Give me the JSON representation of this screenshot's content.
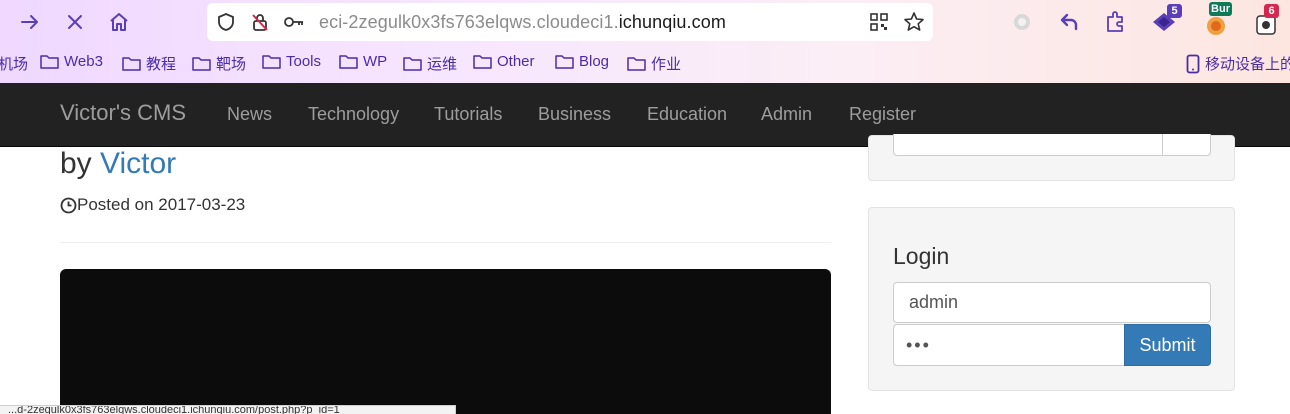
{
  "browser": {
    "url_prefix": "eci-2zegulk0x3fs763elqws.cloudeci1.",
    "url_domain": "ichunqiu.com",
    "extensions": [
      {
        "name": "puzzle-extension",
        "badge": ""
      },
      {
        "name": "undo-extension",
        "badge": ""
      },
      {
        "name": "extensions-icon",
        "badge": ""
      },
      {
        "name": "hackbar-extension",
        "badge": "5"
      },
      {
        "name": "burp-extension",
        "badge": "Bur"
      },
      {
        "name": "ublock-extension",
        "badge": "6"
      }
    ],
    "bookmarks": [
      {
        "label": "机场",
        "folder": false
      },
      {
        "label": "Web3",
        "folder": true
      },
      {
        "label": "教程",
        "folder": true
      },
      {
        "label": "靶场",
        "folder": true
      },
      {
        "label": "Tools",
        "folder": true
      },
      {
        "label": "WP",
        "folder": true
      },
      {
        "label": "运维",
        "folder": true
      },
      {
        "label": "Other",
        "folder": true
      },
      {
        "label": "Blog",
        "folder": true
      },
      {
        "label": "作业",
        "folder": true
      }
    ],
    "mobile_bookmarks": "移动设备上的",
    "colors": {
      "accent": "#5b3fb8",
      "bookmark_text": "#4a2ca8"
    }
  },
  "site": {
    "brand": "Victor's CMS",
    "nav": [
      "News",
      "Technology",
      "Tutorials",
      "Business",
      "Education",
      "Admin",
      "Register"
    ]
  },
  "post": {
    "by": "by",
    "author": "Victor",
    "posted_prefix": "Posted on",
    "date": "2017-03-23"
  },
  "sidebar": {
    "login": {
      "title": "Login",
      "username_value": "admin",
      "password_value": "•••",
      "submit_label": "Submit"
    }
  },
  "statusbar": {
    "text": "...d-2zegulk0x3fs763elqws.cloudeci1.ichunqiu.com/post.php?p_id=1"
  },
  "colors": {
    "navbar_bg": "#222222",
    "nav_text": "#9d9d9d",
    "link": "#337ab7",
    "button": "#337ab7"
  }
}
